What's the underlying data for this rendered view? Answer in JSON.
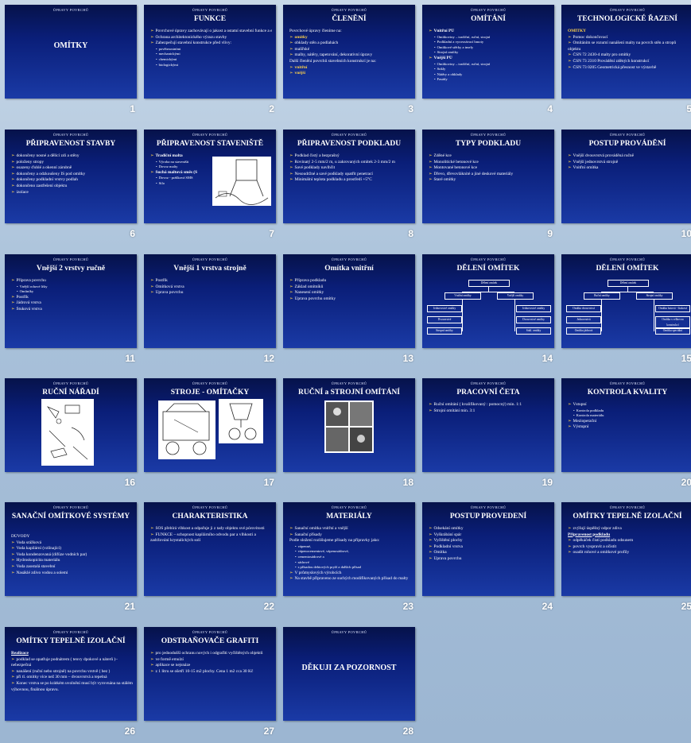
{
  "header_text": "ÚPRAVY POVRCHŮ",
  "slides": [
    {
      "n": "1",
      "title": "OMÍTKY",
      "items": []
    },
    {
      "n": "2",
      "title": "FUNKCE",
      "items": [
        {
          "t": "Povrchové úpravy zachovávají o jakost a ostatní stavební funkce a estetičnost",
          "l": 1
        },
        {
          "t": "Ochrana architektonického výrazu stavby",
          "l": 1
        },
        {
          "t": "Zabezpečují stavební konstrukce před vlivy:",
          "l": 1
        },
        {
          "t": "povětrnostními",
          "l": 2
        },
        {
          "t": "mechanickými",
          "l": 2
        },
        {
          "t": "chemickými",
          "l": 2
        },
        {
          "t": "biologickými",
          "l": 2
        }
      ]
    },
    {
      "n": "3",
      "title": "ČLENĚNÍ",
      "items": [
        {
          "t": "Povrchové úpravy členíme na:",
          "l": 0
        },
        {
          "t": "omítky",
          "l": 1,
          "y": true
        },
        {
          "t": "obklady stěn a podlahách",
          "l": 1
        },
        {
          "t": "malířské",
          "l": 1
        },
        {
          "t": "malby, nátěry, tapetování, dekorativní úpravy",
          "l": 1
        },
        {
          "t": "Další členění povrchů stavebních konstrukcí je na:",
          "l": 0
        },
        {
          "t": "vnitřní",
          "l": 1,
          "y": true
        },
        {
          "t": "vnější",
          "l": 1,
          "y": true
        }
      ]
    },
    {
      "n": "4",
      "title": "OMÍTÁNÍ",
      "items": [
        {
          "t": "Vnitřní PÚ",
          "l": 1,
          "b": true
        },
        {
          "t": "Omítkoviny – tradiční, ruční, strojní",
          "l": 2
        },
        {
          "t": "Podkladní a vyrovnávací hmoty",
          "l": 2
        },
        {
          "t": "Omítkové stěrky a tmely",
          "l": 2
        },
        {
          "t": "Strojní omítky",
          "l": 2
        },
        {
          "t": "Vnější PÚ",
          "l": 1,
          "b": true
        },
        {
          "t": "Omítkoviny – tradiční, ruční, strojní",
          "l": 2
        },
        {
          "t": "Sokly",
          "l": 2
        },
        {
          "t": "Nátěry a obklady",
          "l": 2
        },
        {
          "t": "Fasády",
          "l": 2
        }
      ]
    },
    {
      "n": "5",
      "title": "TECHNOLOGICKÉ ŘAZENÍ",
      "items": [
        {
          "t": "OMÍTKY",
          "l": 0,
          "y": true
        },
        {
          "t": "Pomoc dokončovací",
          "l": 1
        },
        {
          "t": "Omítáním se rozumí nanášení malty na povrch stěn a stropů objektu",
          "l": 1,
          "w": true
        },
        {
          "t": "ČSN 72 2430-4 malty pro omítky",
          "l": 1
        },
        {
          "t": "ČSN 73 2310 Provádění zděných konstrukcí",
          "l": 1
        },
        {
          "t": "ČSN 73 0205 Geometrická přesnost ve výstavbě",
          "l": 1
        }
      ]
    },
    {
      "n": "6",
      "title": "PŘIPRAVENOST STAVBY",
      "items": [
        {
          "t": "dokončeny nosné a dělicí zdi a stěny",
          "l": 1
        },
        {
          "t": "položeny stropy",
          "l": 1
        },
        {
          "t": "osazeny ďuhlé a okenní zárubně",
          "l": 1
        },
        {
          "t": "dokončeny a odzkoušeny IS pod omítky",
          "l": 1
        },
        {
          "t": "dokončeny podkladní vrstvy podlah",
          "l": 1
        },
        {
          "t": "dokončeno zastřešení objektu",
          "l": 1
        },
        {
          "t": "izolace",
          "l": 1
        }
      ]
    },
    {
      "n": "7",
      "title": "PŘIPRAVENOST STAVENIŠTĚ",
      "items": [
        {
          "t": "Tradiční malta",
          "l": 1,
          "b": true
        },
        {
          "t": "Výroba na staveništi",
          "l": 2
        },
        {
          "t": "Dovoz malty",
          "l": 2
        },
        {
          "t": "Suchá maltová směs (S",
          "l": 1,
          "b": true
        },
        {
          "t": "Dovoz - prášková SMS",
          "l": 2
        },
        {
          "t": "Silo",
          "l": 2
        }
      ]
    },
    {
      "n": "8",
      "title": "PŘIPRAVENOST PODKLADU",
      "items": [
        {
          "t": "Podklad čistý a bezprašný",
          "l": 1
        },
        {
          "t": "Rovinatý 2-5 mm/2 m, u zakrovaných omítek 2-3 mm/2 m",
          "l": 1,
          "w": true
        },
        {
          "t": "Savé podklady navlhčit",
          "l": 1
        },
        {
          "t": "Nesoudržné a savé podklady opatřit penetrací",
          "l": 1,
          "w": true
        },
        {
          "t": "Minimální teplota podkladu a prostředí +5°C",
          "l": 1
        }
      ]
    },
    {
      "n": "9",
      "title": "TYPY PODKLADU",
      "items": [
        {
          "t": "Zděné kce",
          "l": 1
        },
        {
          "t": "Monolitické betonové kce",
          "l": 1
        },
        {
          "t": "Montované betonové kce",
          "l": 1
        },
        {
          "t": "Dřevo, dřevovláknité a jiné deskové materiály",
          "l": 1
        },
        {
          "t": "Staré omítky",
          "l": 1
        }
      ]
    },
    {
      "n": "10",
      "title": "POSTUP PROVÁDĚNÍ",
      "items": [
        {
          "t": "Vnější dvouvrstvá prováděná ručně",
          "l": 1
        },
        {
          "t": "Vnější jednovrstvá strojně",
          "l": 1
        },
        {
          "t": "Vnitřní omítka",
          "l": 1
        }
      ]
    },
    {
      "n": "11",
      "title": "Vnější 2 vrstvy ručně",
      "items": [
        {
          "t": "Příprava povrchu",
          "l": 1
        },
        {
          "t": "Vnější rohové lišty",
          "l": 2
        },
        {
          "t": "Omítníky",
          "l": 2
        },
        {
          "t": "Postřik",
          "l": 1
        },
        {
          "t": "Jádrová vrstva",
          "l": 1
        },
        {
          "t": "Štuková vrstva",
          "l": 1
        }
      ]
    },
    {
      "n": "12",
      "title": "Vnější 1 vrstva strojně",
      "items": [
        {
          "t": "Postřik",
          "l": 1
        },
        {
          "t": "Omítková vrstva",
          "l": 1
        },
        {
          "t": "Úprava povrchu",
          "l": 1
        }
      ]
    },
    {
      "n": "13",
      "title": "Omítka vnitřní",
      "items": [
        {
          "t": "Příprava podkladu",
          "l": 1
        },
        {
          "t": "Základ omítníků",
          "l": 1
        },
        {
          "t": "Nanesení omítky",
          "l": 1
        },
        {
          "t": "Úprava povrchu omítky",
          "l": 1
        }
      ]
    },
    {
      "n": "14",
      "title": "DĚLENÍ OMÍTEK",
      "items": []
    },
    {
      "n": "15",
      "title": "DĚLENÍ OMÍTEK",
      "items": []
    },
    {
      "n": "16",
      "title": "RUČNÍ NÁŘADÍ",
      "items": []
    },
    {
      "n": "17",
      "title": "STROJE - OMÍTAČKY",
      "items": []
    },
    {
      "n": "18",
      "title": "RUČNÍ a STROJNÍ OMÍTÁNÍ",
      "items": []
    },
    {
      "n": "19",
      "title": "PRACOVNÍ ČETA",
      "items": [
        {
          "t": "Ruční omítání ( kvalifikovaný : pomocný) min. 1:1",
          "l": 1,
          "w": true
        },
        {
          "t": "Strojní omítání min. 3:1",
          "l": 1
        }
      ]
    },
    {
      "n": "20",
      "title": "KONTROLA KVALITY",
      "items": [
        {
          "t": "Vstupní",
          "l": 1
        },
        {
          "t": "Kontrola podkladu",
          "l": 2
        },
        {
          "t": "Kontrola materiálu",
          "l": 2
        },
        {
          "t": "Mezioperační",
          "l": 1
        },
        {
          "t": "Výstupní",
          "l": 1
        }
      ]
    },
    {
      "n": "21",
      "title": "SANAČNÍ OMÍTKOVÉ SYSTÉMY",
      "items": [
        {
          "t": "DŮVODY",
          "l": 0
        },
        {
          "t": "Voda srážková",
          "l": 1
        },
        {
          "t": "Voda kapilární (vzlínající)",
          "l": 1
        },
        {
          "t": "Voda kondenzovaná (difúze vodních par)",
          "l": 1
        },
        {
          "t": "Hydroskopicita materiálu",
          "l": 1
        },
        {
          "t": "Voda zaostalá stavební",
          "l": 1
        },
        {
          "t": "Nasáklé zdivo vodou a solemi",
          "l": 1
        }
      ]
    },
    {
      "n": "22",
      "title": "CHARAKTERISTIKA",
      "items": [
        {
          "t": "SOS přebírá vlhkost a odpařuje ji z tady objektu své pórovitosti",
          "l": 1,
          "w": true
        },
        {
          "t": "FUNKCE – schopnost kapilárního odvodu par a vlhkosti a zadržování krystalických solí",
          "l": 1,
          "w": true
        }
      ]
    },
    {
      "n": "23",
      "title": "MATERIÁLY",
      "items": [
        {
          "t": "Sanační omítka vnitřní a vnější",
          "l": 1
        },
        {
          "t": "Sanační přísady",
          "l": 1
        },
        {
          "t": "Podle složení rozlišujeme přísady na přípravky jako:",
          "l": 0
        },
        {
          "t": "vápenné,",
          "l": 2
        },
        {
          "t": "vápenocementové, vápenosádrové,",
          "l": 2
        },
        {
          "t": "cementosádrové a",
          "l": 2
        },
        {
          "t": "sádrové",
          "l": 2
        },
        {
          "t": "s přísadou dehtových pryží a dalších přísad",
          "l": 2
        },
        {
          "t": "V průmyslových výrobcích",
          "l": 1
        },
        {
          "t": "Na stavbě připraveno ze suchých modifikovaných přísad do malty",
          "l": 1
        }
      ]
    },
    {
      "n": "24",
      "title": "POSTUP PROVEDENÍ",
      "items": [
        {
          "t": "Odsekání omítky",
          "l": 1
        },
        {
          "t": "Vyškrábání spár",
          "l": 1
        },
        {
          "t": "Vyčištění plochy",
          "l": 1
        },
        {
          "t": "Podkladní vrstva",
          "l": 1
        },
        {
          "t": "Omítka",
          "l": 1
        },
        {
          "t": "Úprava povrchu",
          "l": 1
        }
      ]
    },
    {
      "n": "25",
      "title": "OMÍTKY TEPELNĚ IZOLAČNÍ",
      "items": [
        {
          "t": "zvýšují úspěšný odpor zdiva",
          "l": 1
        },
        {
          "t": "Připravenost podkladu",
          "l": 0,
          "u": true
        },
        {
          "t": "odpěkáček čistí podkladu odsunem",
          "l": 1
        },
        {
          "t": "povrch vyspravit a očistit",
          "l": 1
        },
        {
          "t": "osadit rohové a omítkové profily",
          "l": 1
        }
      ]
    },
    {
      "n": "26",
      "title": "OMÍTKY TEPELNĚ IZOLAČNÍ",
      "items": [
        {
          "t": "Realizace",
          "l": 0,
          "u": true
        },
        {
          "t": "podklad se opatřuje podnátrem ( tenvy dpokové a náterů )– nebezpečná",
          "l": 1,
          "w": true
        },
        {
          "t": "nanášení (ruční nebo strojně) na povrchu vrstvě ( bez )",
          "l": 1
        },
        {
          "t": "při tl. omítky více než 30 mm – dvouvrstvá a tepelná",
          "l": 1
        },
        {
          "t": "Konec vrstva se po krátkém uvolnění musí být vyrovnána na stálém výhovnou, finálnou úpravu.",
          "l": 1,
          "w": true
        }
      ]
    },
    {
      "n": "27",
      "title": "ODSTRAŇOVAČE GRAFITI",
      "items": [
        {
          "t": "pro jednodušší ochranu nových i odgrafiti vyčištěných objektů",
          "l": 1,
          "w": true
        },
        {
          "t": "ve formě emulzí",
          "l": 1
        },
        {
          "t": "aplikace se nejsnáze",
          "l": 1
        },
        {
          "t": "z 1 litru se ošetří 10-15 m2 plochy. Cena 1 m2 cca 30 Kč",
          "l": 1,
          "w": true
        }
      ]
    },
    {
      "n": "28",
      "title": "DĚKUJI ZA POZORNOST",
      "items": []
    }
  ],
  "diagram14": {
    "root": "Dělení omítek",
    "l1": [
      "Vnitřní omítky",
      "Vnější omítky"
    ],
    "left": [
      "Jednovrstvé omítky",
      "Dvouvrstvé",
      "Stropní omítky"
    ],
    "right": [
      "Jednovrstvé omítky",
      "Dvouvrstvé omítky",
      "Sokl. omítky"
    ]
  },
  "diagram15": {
    "root": "Dělení omítek",
    "l1": [
      "Ruční omítky",
      "Strojní omítky"
    ],
    "left": [
      "Omítka dvouvrstvá",
      "Jednovrstvá",
      "Omítka jádrová"
    ],
    "right": [
      "Omítka hotová - štuková",
      "Omítka s celkovou konstrukcí",
      "Omítka speciální"
    ]
  },
  "colors": {
    "accent": "#ffd24a",
    "slide_dark": "#06124a",
    "slide_light": "#1a3aa6"
  }
}
